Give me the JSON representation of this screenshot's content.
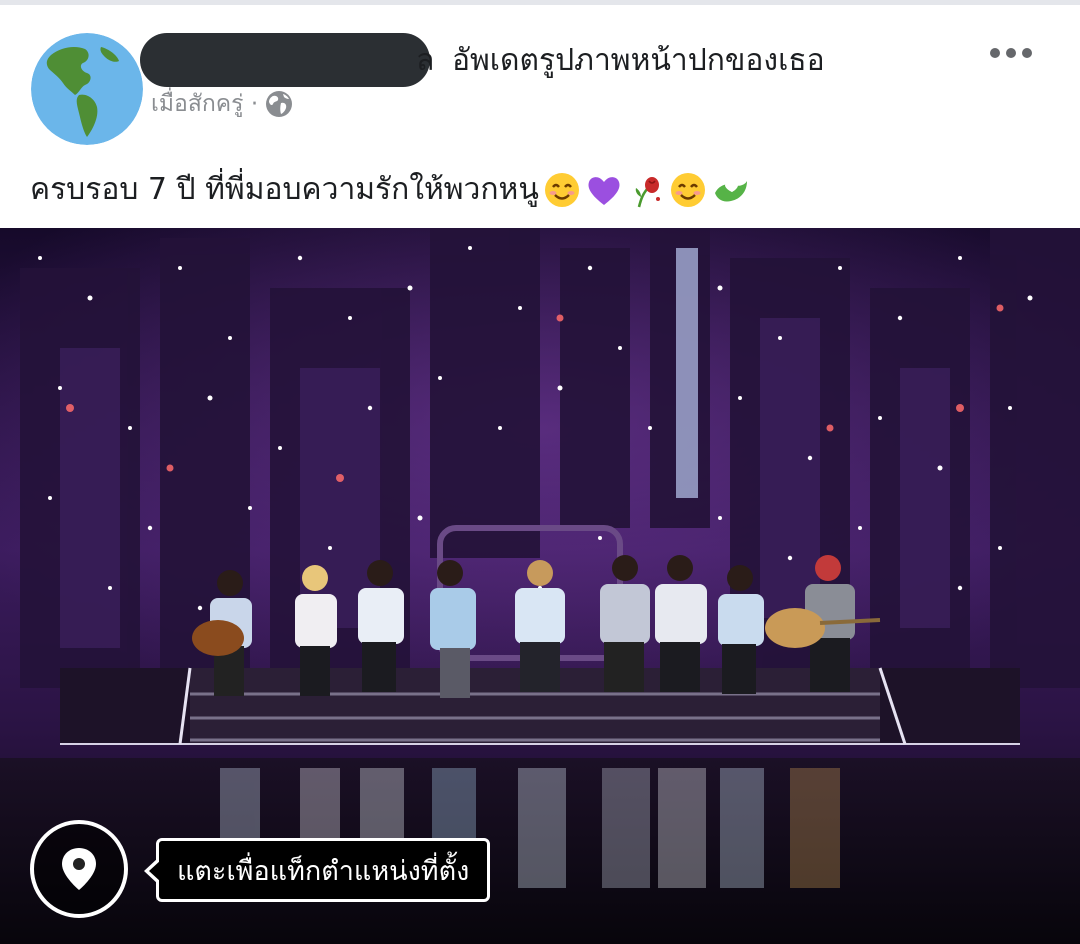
{
  "post": {
    "author_redacted_tail": "ล",
    "action_text": "อัพเดตรูปภาพหน้าปกของเธอ",
    "timestamp": "เมื่อสักครู่ ·",
    "audience_icon": "globe-icon",
    "more_icon": "more-options-icon",
    "text": "ครบรอบ 7 ปี ที่พี่มอบความรักให้พวกหนู",
    "emojis": [
      "smiling-face-icon",
      "purple-heart-icon",
      "wilted-rose-icon",
      "smiling-face-icon",
      "hands-heart-icon"
    ]
  },
  "photo": {
    "icon": "location-pin-icon",
    "tag_location_hint": "แตะเพื่อแท็กตำแหน่งที่ตั้ง"
  },
  "colors": {
    "text_primary": "#1c1e21",
    "text_secondary": "#8a8d91",
    "stage_purple": "#3a1b5c"
  }
}
